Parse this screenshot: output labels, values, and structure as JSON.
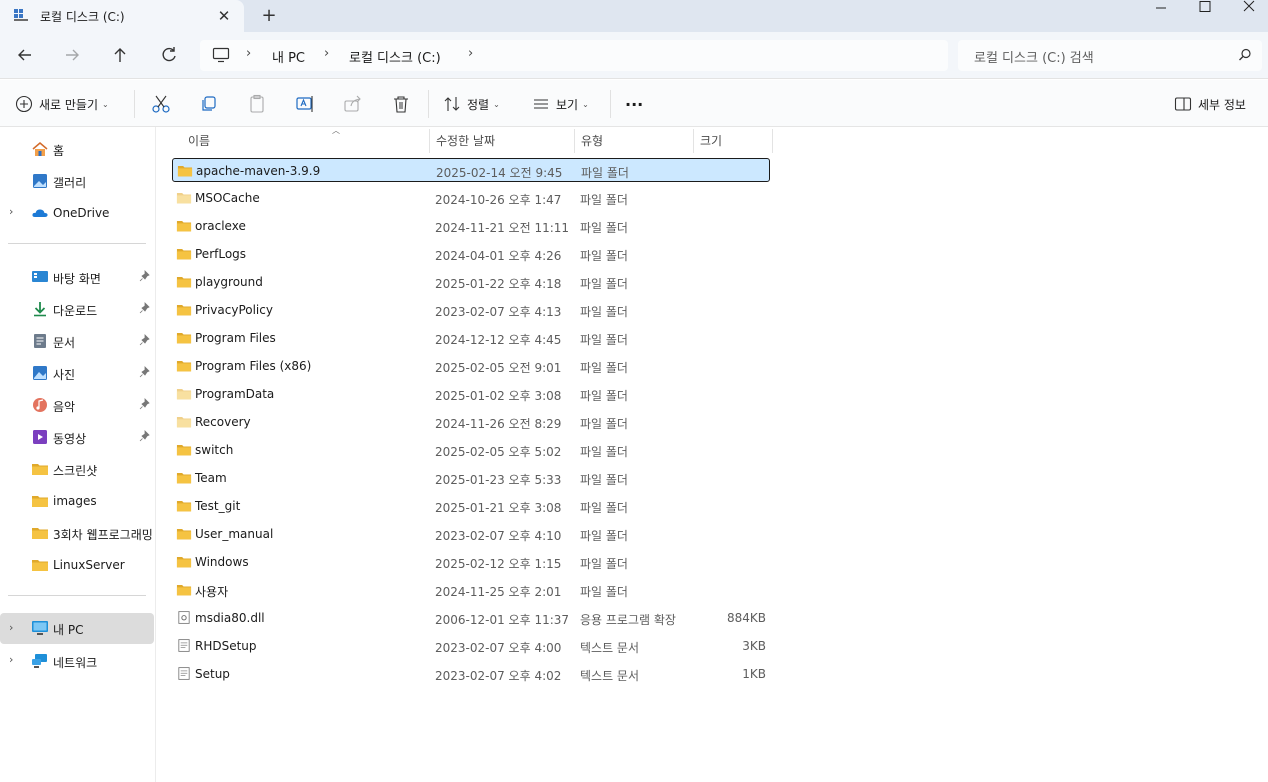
{
  "tab": {
    "title": "로컬 디스크 (C:)",
    "close": "✕",
    "new_tab": "+"
  },
  "window": {
    "minimize": "—",
    "maximize": "☐",
    "close": "✕"
  },
  "address": {
    "segments": [
      "내 PC",
      "로컬 디스크 (C:)"
    ],
    "sep": "›",
    "search_placeholder": "로컬 디스크 (C:) 검색"
  },
  "commands": {
    "new": "새로 만들기",
    "sort": "정렬",
    "view": "보기",
    "more": "···",
    "details": "세부 정보"
  },
  "sidebar": {
    "expand_glyph": "›",
    "top": [
      {
        "label": "홈",
        "icon": "home-icon"
      },
      {
        "label": "갤러리",
        "icon": "gallery-icon"
      },
      {
        "label": "OneDrive",
        "icon": "cloud-icon"
      }
    ],
    "quick": [
      {
        "label": "바탕 화면",
        "icon": "desktop-icon"
      },
      {
        "label": "다운로드",
        "icon": "download-icon"
      },
      {
        "label": "문서",
        "icon": "document-icon"
      },
      {
        "label": "사진",
        "icon": "pictures-icon"
      },
      {
        "label": "음악",
        "icon": "music-icon"
      },
      {
        "label": "동영상",
        "icon": "video-icon"
      },
      {
        "label": "스크린샷",
        "icon": "folder-icon"
      },
      {
        "label": "images",
        "icon": "folder-icon"
      },
      {
        "label": "3회차 웹프로그래밍",
        "icon": "folder-icon"
      },
      {
        "label": "LinuxServer",
        "icon": "folder-icon"
      }
    ],
    "bottom": [
      {
        "label": "내 PC",
        "icon": "computer-icon"
      },
      {
        "label": "네트워크",
        "icon": "network-icon"
      }
    ]
  },
  "columns": {
    "name": "이름",
    "date": "수정한 날짜",
    "type": "유형",
    "size": "크기"
  },
  "files": [
    {
      "name": "apache-maven-3.9.9",
      "date": "2025-02-14 오전 9:45",
      "type": "파일 폴더",
      "size": "",
      "kind": "folder"
    },
    {
      "name": "MSOCache",
      "date": "2024-10-26 오후 1:47",
      "type": "파일 폴더",
      "size": "",
      "kind": "folder-hidden"
    },
    {
      "name": "oraclexe",
      "date": "2024-11-21 오전 11:11",
      "type": "파일 폴더",
      "size": "",
      "kind": "folder"
    },
    {
      "name": "PerfLogs",
      "date": "2024-04-01 오후 4:26",
      "type": "파일 폴더",
      "size": "",
      "kind": "folder"
    },
    {
      "name": "playground",
      "date": "2025-01-22 오후 4:18",
      "type": "파일 폴더",
      "size": "",
      "kind": "folder"
    },
    {
      "name": "PrivacyPolicy",
      "date": "2023-02-07 오후 4:13",
      "type": "파일 폴더",
      "size": "",
      "kind": "folder"
    },
    {
      "name": "Program Files",
      "date": "2024-12-12 오후 4:45",
      "type": "파일 폴더",
      "size": "",
      "kind": "folder"
    },
    {
      "name": "Program Files (x86)",
      "date": "2025-02-05 오전 9:01",
      "type": "파일 폴더",
      "size": "",
      "kind": "folder"
    },
    {
      "name": "ProgramData",
      "date": "2025-01-02 오후 3:08",
      "type": "파일 폴더",
      "size": "",
      "kind": "folder-hidden"
    },
    {
      "name": "Recovery",
      "date": "2024-11-26 오전 8:29",
      "type": "파일 폴더",
      "size": "",
      "kind": "folder-hidden"
    },
    {
      "name": "switch",
      "date": "2025-02-05 오후 5:02",
      "type": "파일 폴더",
      "size": "",
      "kind": "folder"
    },
    {
      "name": "Team",
      "date": "2025-01-23 오후 5:33",
      "type": "파일 폴더",
      "size": "",
      "kind": "folder"
    },
    {
      "name": "Test_git",
      "date": "2025-01-21 오후 3:08",
      "type": "파일 폴더",
      "size": "",
      "kind": "folder"
    },
    {
      "name": "User_manual",
      "date": "2023-02-07 오후 4:10",
      "type": "파일 폴더",
      "size": "",
      "kind": "folder"
    },
    {
      "name": "Windows",
      "date": "2025-02-12 오후 1:15",
      "type": "파일 폴더",
      "size": "",
      "kind": "folder"
    },
    {
      "name": "사용자",
      "date": "2024-11-25 오후 2:01",
      "type": "파일 폴더",
      "size": "",
      "kind": "folder"
    },
    {
      "name": "msdia80.dll",
      "date": "2006-12-01 오후 11:37",
      "type": "응용 프로그램 확장",
      "size": "884KB",
      "kind": "dll"
    },
    {
      "name": "RHDSetup",
      "date": "2023-02-07 오후 4:00",
      "type": "텍스트 문서",
      "size": "3KB",
      "kind": "text"
    },
    {
      "name": "Setup",
      "date": "2023-02-07 오후 4:02",
      "type": "텍스트 문서",
      "size": "1KB",
      "kind": "text"
    }
  ],
  "selected_index": 0,
  "colors": {
    "folder": "#f5c342",
    "folder_dark": "#e0a92b",
    "accent": "#0067c0",
    "selection": "#cce8ff"
  }
}
